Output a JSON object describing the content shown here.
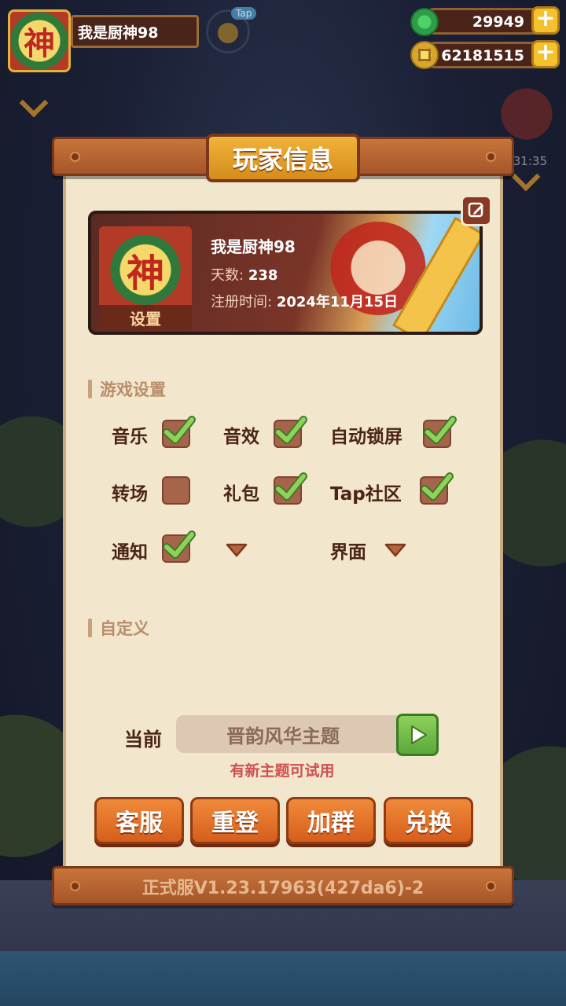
{
  "hud": {
    "player_name": "我是厨神98",
    "avatar_glyph": "神",
    "tap_label": "Tap",
    "jade_amount": "29949",
    "coin_amount": "62181515",
    "plus_symbol": "+"
  },
  "background": {
    "right_timer": "31:35"
  },
  "dialog": {
    "title": "玩家信息",
    "profile": {
      "avatar_glyph": "神",
      "settings_tag": "设置",
      "name": "我是厨神98",
      "days_label": "天数:",
      "days_value": "238",
      "register_label": "注册时间:",
      "register_value": "2024年11月15日"
    },
    "game_settings": {
      "heading": "游戏设置",
      "items": [
        {
          "label": "音乐",
          "checked": true
        },
        {
          "label": "音效",
          "checked": true
        },
        {
          "label": "自动锁屏",
          "checked": true
        },
        {
          "label": "转场",
          "checked": false
        },
        {
          "label": "礼包",
          "checked": true
        },
        {
          "label": "Tap社区",
          "checked": true
        },
        {
          "label": "通知",
          "checked": true
        }
      ],
      "interface_label": "界面"
    },
    "custom": {
      "heading": "自定义",
      "current_label": "当前",
      "theme_name": "晋韵风华主题",
      "theme_hint": "有新主题可试用"
    },
    "actions": [
      "客服",
      "重登",
      "加群",
      "兑换"
    ],
    "version": "正式服V1.23.17963(427da6)-2"
  },
  "colors": {
    "wood": "#b5602e",
    "panel": "#f2e6cd",
    "check_green": "#7cc44a",
    "action_orange": "#e8752c"
  }
}
